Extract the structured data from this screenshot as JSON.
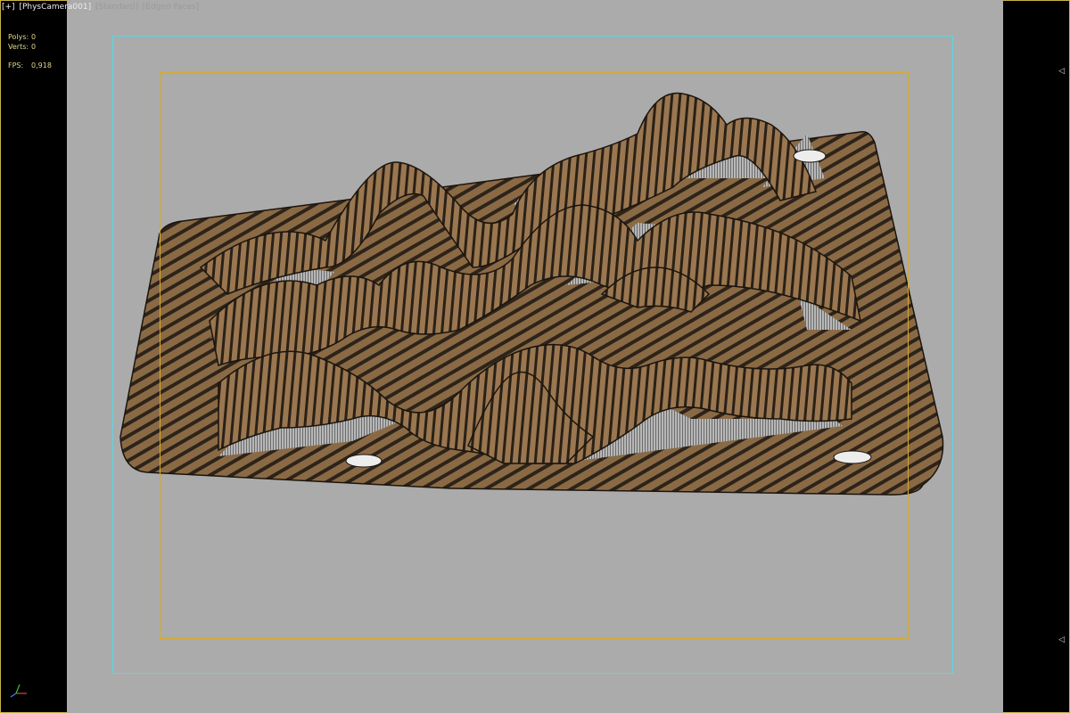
{
  "viewport": {
    "label_plus": "[+]",
    "label_camera": "[PhysCamera001]",
    "label_shading": "[Standard]",
    "label_mode": "[Edged Faces]"
  },
  "stats": {
    "polys_label": "Polys:",
    "polys_value": "0",
    "verts_label": "Verts:",
    "verts_value": "0",
    "fps_label": "FPS:",
    "fps_value": "0,918"
  },
  "colors": {
    "background": "#ababab",
    "wood_light": "#8a6a45",
    "wood_dark": "#2d2319",
    "safe_frame_outer": "#5fd6e0",
    "safe_frame_inner": "#d6a92c"
  },
  "icons": {
    "axis": "axis-gizmo-icon",
    "viewport_arrow": "triangle-left-icon"
  }
}
